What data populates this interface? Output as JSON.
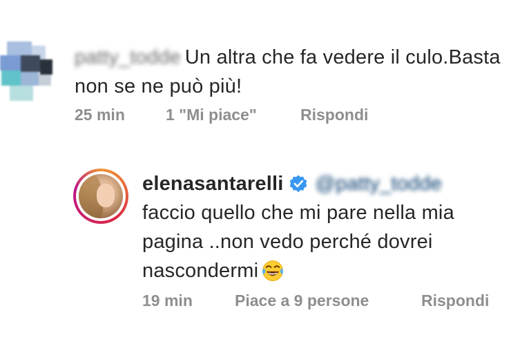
{
  "comments": [
    {
      "username": "patty_todde",
      "text": "Un altra che fa vedere il culo.Basta non se ne può più!",
      "time": "25 min",
      "likes": "1 \"Mi piace\"",
      "reply_label": "Rispondi"
    },
    {
      "username": "elenasantarelli",
      "verified": true,
      "mention": "@patty_todde",
      "text": "faccio quello che mi pare nella mia pagina ..non vedo perché dovrei nascondermi",
      "emoji": "face-with-tears-of-joy",
      "time": "19 min",
      "likes": "Piace a 9 persone",
      "reply_label": "Rispondi"
    }
  ],
  "colors": {
    "text": "#262626",
    "meta": "#8e8e8e",
    "verified": "#3897f0",
    "mention": "#00376b"
  }
}
